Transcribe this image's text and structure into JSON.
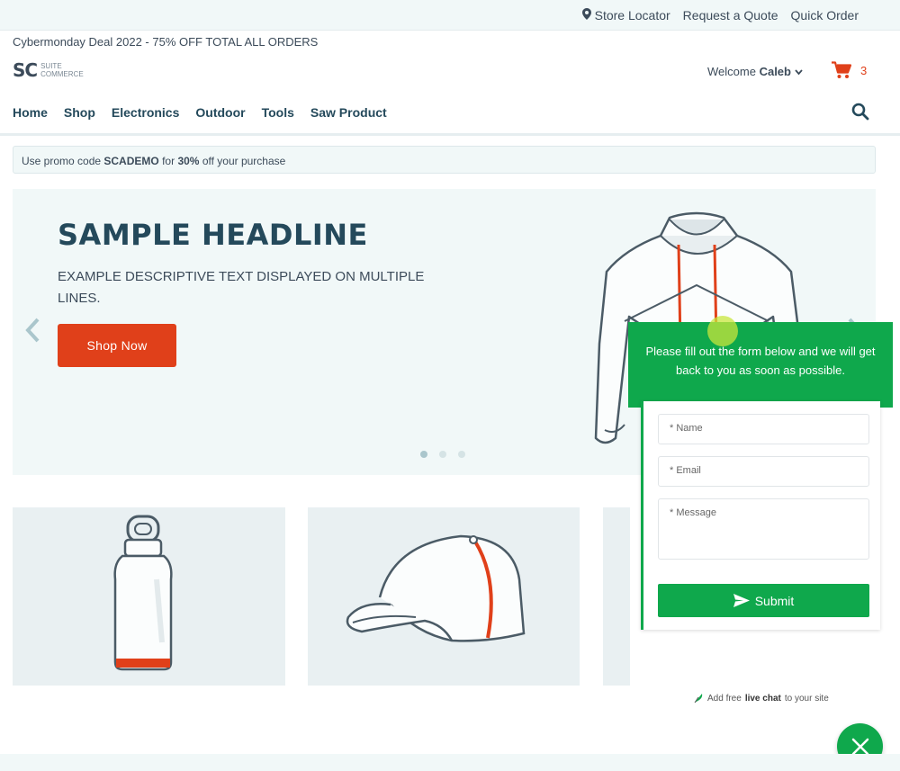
{
  "topbar": {
    "store_locator": "Store Locator",
    "request_quote": "Request a Quote",
    "quick_order": "Quick Order"
  },
  "announcement": "Cybermonday Deal 2022 - 75% OFF TOTAL ALL ORDERS",
  "logo": {
    "mark": "SC",
    "line1": "SUITE",
    "line2": "COMMERCE"
  },
  "header": {
    "welcome_prefix": "Welcome",
    "user_name": "Caleb",
    "cart_count": "3"
  },
  "nav": {
    "items": [
      "Home",
      "Shop",
      "Electronics",
      "Outdoor",
      "Tools",
      "Saw Product"
    ]
  },
  "promo": {
    "prefix": "Use promo code",
    "code": "SCADEMO",
    "middle": "for",
    "percent": "30%",
    "suffix": "off your purchase"
  },
  "hero": {
    "headline": "SAMPLE HEADLINE",
    "description": "EXAMPLE DESCRIPTIVE TEXT DISPLAYED ON MULTIPLE LINES.",
    "cta": "Shop Now",
    "slide_count": 3,
    "active_slide": 1
  },
  "chat_widget": {
    "intro": "Please fill out the form below and we will get back to you as soon as possible.",
    "name_placeholder": "* Name",
    "email_placeholder": "* Email",
    "message_placeholder": "* Message",
    "submit_label": "Submit",
    "footer_prefix": "Add free",
    "footer_bold": "live chat",
    "footer_suffix": "to your site"
  },
  "colors": {
    "accent": "#e0401a",
    "chat_green": "#0fa84c",
    "nav_text": "#24495b",
    "panel_bg": "#f1f8f8"
  }
}
